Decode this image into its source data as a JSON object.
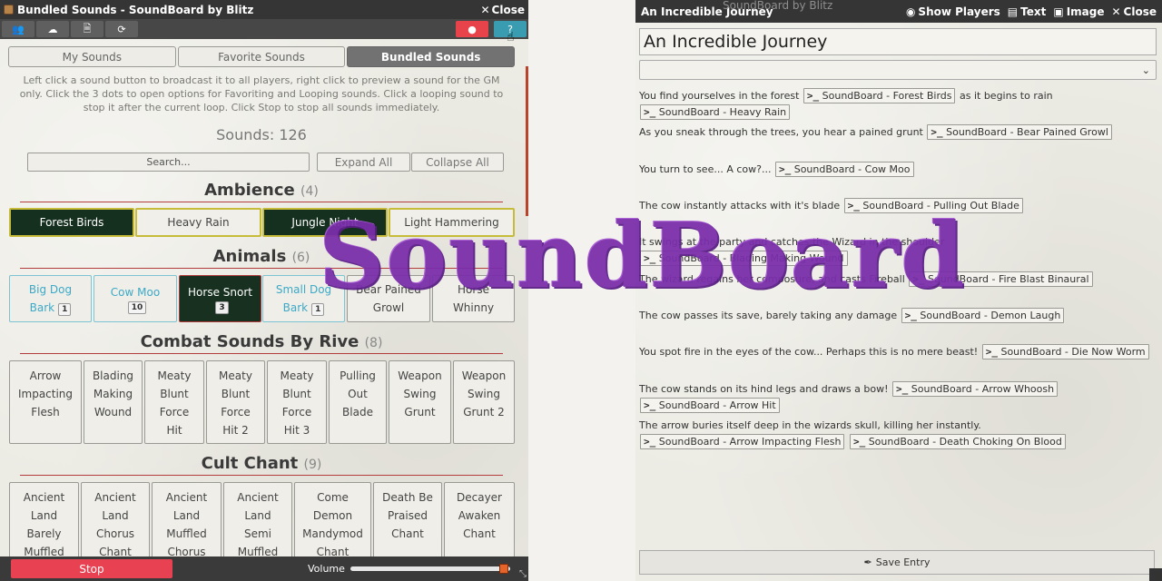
{
  "left": {
    "title": "Bundled Sounds - SoundBoard by Blitz",
    "close": "Close",
    "toolbar": {
      "players_icon": "users-icon",
      "download_icon": "cloud-download-icon",
      "file_icon": "file-icon",
      "refresh_icon": "refresh-icon",
      "record_icon": "record-icon",
      "help_icon": "help-icon"
    },
    "tabs": [
      "My Sounds",
      "Favorite Sounds",
      "Bundled Sounds"
    ],
    "hint": "Left click a sound button to broadcast it to all players, right click to preview a sound for the GM only. Click the 3 dots to open options for Favoriting and Looping sounds. Click a looping sound to stop it after the current loop. Click Stop to stop all sounds immediately.",
    "sounds_count": "Sounds: 126",
    "search_placeholder": "Search...",
    "expand": "Expand All",
    "collapse": "Collapse All",
    "sections": [
      {
        "name": "Ambience",
        "count": "(4)",
        "items": [
          "Forest Birds",
          "Heavy Rain",
          "Jungle Night",
          "Light Hammering"
        ]
      },
      {
        "name": "Animals",
        "count": "(6)",
        "items": [
          {
            "l1": "Big Dog",
            "l2": "Bark",
            "b": "1"
          },
          {
            "l1": "Cow Moo",
            "l2": "",
            "b": "10"
          },
          {
            "l1": "Horse Snort",
            "l2": "",
            "b": "3"
          },
          {
            "l1": "Small Dog",
            "l2": "Bark",
            "b": "1"
          },
          {
            "l1": "Bear Pained",
            "l2": "Growl",
            "b": ""
          },
          {
            "l1": "Horse",
            "l2": "Whinny",
            "b": ""
          }
        ]
      },
      {
        "name": "Combat Sounds By Rive",
        "count": "(8)",
        "items": [
          [
            "Arrow",
            "Impacting",
            "Flesh"
          ],
          [
            "Blading",
            "Making",
            "Wound"
          ],
          [
            "Meaty",
            "Blunt",
            "Force",
            "Hit"
          ],
          [
            "Meaty",
            "Blunt",
            "Force",
            "Hit 2"
          ],
          [
            "Meaty",
            "Blunt",
            "Force",
            "Hit 3"
          ],
          [
            "Pulling",
            "Out",
            "Blade"
          ],
          [
            "Weapon",
            "Swing",
            "Grunt"
          ],
          [
            "Weapon",
            "Swing",
            "Grunt 2"
          ]
        ]
      },
      {
        "name": "Cult Chant",
        "count": "(9)",
        "items": [
          [
            "Ancient",
            "Land",
            "Barely",
            "Muffled"
          ],
          [
            "Ancient",
            "Land",
            "Chorus",
            "Chant"
          ],
          [
            "Ancient",
            "Land",
            "Muffled",
            "Chorus"
          ],
          [
            "Ancient",
            "Land",
            "Semi",
            "Muffled"
          ],
          [
            "Come",
            "Demon",
            "Mandymod",
            "Chant"
          ],
          [
            "Death Be",
            "Praised",
            "Chant"
          ],
          [
            "Decayer",
            "Awaken",
            "Chant"
          ]
        ]
      }
    ],
    "stop": "Stop",
    "volume": "Volume",
    "volume_level": 0.97
  },
  "right": {
    "title": "An Incredible Journey",
    "ghost_title": "SoundBoard by Blitz",
    "actions": {
      "show_players": "Show Players",
      "text": "Text",
      "image": "Image",
      "close": "Close"
    },
    "name_value": "An Incredible Journey",
    "paragraphs": [
      {
        "t": "You find yourselves in the forest",
        "c": "SoundBoard - Forest Birds",
        "t2": "as it begins to rain",
        "c2": "SoundBoard - Heavy Rain"
      },
      {
        "t": "As you sneak through the trees, you hear a pained grunt",
        "c": "SoundBoard - Bear Pained Growl"
      },
      {
        "t": "You turn to see... A cow?...",
        "c": "SoundBoard - Cow Moo"
      },
      {
        "t": "The cow instantly attacks with it's blade",
        "c": "SoundBoard - Pulling Out Blade"
      },
      {
        "t": "It swings at the party and catches the Wizard in the shoulder",
        "c": "SoundBoard - Blading Making Wound"
      },
      {
        "t": "The wizard regains her composure, and casts Fireball",
        "c": "SoundBoard - Fire Blast Binaural"
      },
      {
        "t": "The cow passes its save, barely taking any damage",
        "c": "SoundBoard - Demon Laugh"
      },
      {
        "t": "You spot fire in the eyes of the cow... Perhaps this is no mere beast!",
        "c": "SoundBoard - Die Now Worm"
      },
      {
        "t": "The cow stands on its hind legs and draws a bow!",
        "c": "SoundBoard - Arrow Whoosh",
        "c2": "SoundBoard - Arrow Hit"
      },
      {
        "t": "The arrow buries itself deep in the wizards skull, killing her instantly.",
        "c": "SoundBoard - Arrow Impacting Flesh",
        "c2": "SoundBoard - Death Choking On Blood"
      }
    ],
    "cmd_glyph": ">_",
    "save": "Save Entry"
  },
  "logo": "SoundBoard"
}
